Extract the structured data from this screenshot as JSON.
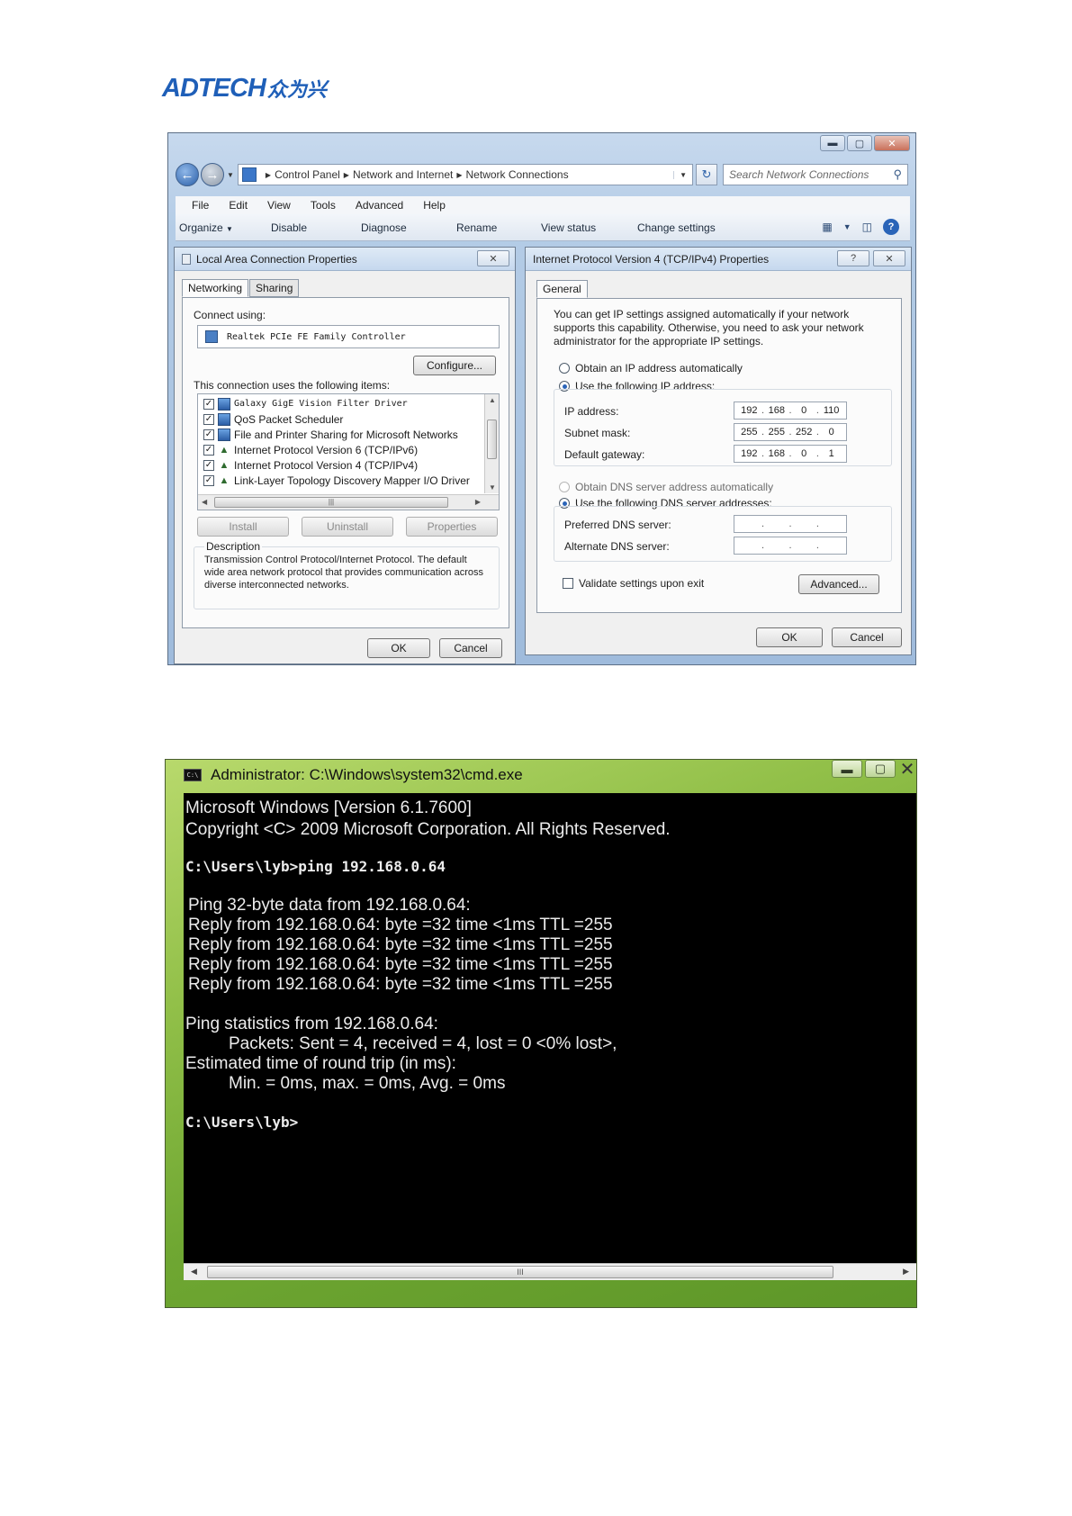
{
  "logo": {
    "latin": "ADTECH",
    "cjk": "众为兴"
  },
  "explorer": {
    "window_controls": {
      "minimize": "▬",
      "maximize": "▢",
      "close": "✕"
    },
    "breadcrumb": [
      "Control Panel",
      "Network and Internet",
      "Network Connections"
    ],
    "search_placeholder": "Search Network Connections",
    "menu": [
      "File",
      "Edit",
      "View",
      "Tools",
      "Advanced",
      "Help"
    ],
    "commands": {
      "organize": "Organize",
      "disable": "Disable",
      "diagnose": "Diagnose",
      "rename": "Rename",
      "view_status": "View status",
      "change_settings": "Change settings"
    }
  },
  "lac_dialog": {
    "title": "Local Area Connection Properties",
    "close": "✕",
    "tabs": [
      "Networking",
      "Sharing"
    ],
    "connect_using_label": "Connect using:",
    "adapter": "Realtek PCIe FE Family Controller",
    "configure": "Configure...",
    "items_label": "This connection uses the following items:",
    "items": [
      {
        "label": "Galaxy GigE Vision Filter Driver",
        "checked": true,
        "icon": "network-component-icon"
      },
      {
        "label": "QoS Packet Scheduler",
        "checked": true,
        "icon": "network-component-icon"
      },
      {
        "label": "File and Printer Sharing for Microsoft Networks",
        "checked": true,
        "icon": "network-component-icon"
      },
      {
        "label": "Internet Protocol Version 6 (TCP/IPv6)",
        "checked": true,
        "icon": "protocol-icon"
      },
      {
        "label": "Internet Protocol Version 4 (TCP/IPv4)",
        "checked": true,
        "icon": "protocol-icon"
      },
      {
        "label": "Link-Layer Topology Discovery Mapper I/O Driver",
        "checked": true,
        "icon": "protocol-icon"
      }
    ],
    "install": "Install",
    "uninstall": "Uninstall",
    "properties": "Properties",
    "description_label": "Description",
    "description": "Transmission Control Protocol/Internet Protocol. The default wide area network protocol that provides communication across diverse interconnected networks.",
    "ok": "OK",
    "cancel": "Cancel"
  },
  "ipv4_dialog": {
    "title": "Internet Protocol Version 4 (TCP/IPv4) Properties",
    "help": "?",
    "close": "✕",
    "tab": "General",
    "intro": "You can get IP settings assigned automatically if your network supports this capability. Otherwise, you need to ask your network administrator for the appropriate IP settings.",
    "obtain_ip": "Obtain an IP address automatically",
    "use_ip": "Use the following IP address:",
    "ip_label": "IP address:",
    "ip": [
      "192",
      "168",
      "0",
      "110"
    ],
    "mask_label": "Subnet mask:",
    "mask": [
      "255",
      "255",
      "252",
      "0"
    ],
    "gateway_label": "Default gateway:",
    "gateway": [
      "192",
      "168",
      "0",
      "1"
    ],
    "obtain_dns": "Obtain DNS server address automatically",
    "use_dns": "Use the following DNS server addresses:",
    "preferred_dns_label": "Preferred DNS server:",
    "alternate_dns_label": "Alternate DNS server:",
    "validate": "Validate settings upon exit",
    "advanced": "Advanced...",
    "ok": "OK",
    "cancel": "Cancel"
  },
  "cmd": {
    "title": "Administrator: C:\\Windows\\system32\\cmd.exe",
    "icon_text": "C:\\",
    "controls": {
      "minimize": "▬",
      "maximize": "▢",
      "close": "✕"
    },
    "lines": {
      "version": "Microsoft Windows [Version 6.1.7600]",
      "copyright": "Copyright <C> 2009 Microsoft Corporation. All Rights Reserved.",
      "prompt_cmd": "C:\\Users\\lyb>ping 192.168.0.64",
      "ping_header": "Ping 32-byte data from 192.168.0.64:",
      "reply1": "Reply from 192.168.0.64: byte =32 time <1ms TTL =255",
      "reply2": "Reply from 192.168.0.64: byte =32 time <1ms TTL =255",
      "reply3": "Reply from 192.168.0.64: byte =32 time <1ms TTL =255",
      "reply4": "Reply from 192.168.0.64: byte =32 time <1ms TTL =255",
      "stats_header": "Ping statistics from 192.168.0.64:",
      "packets": "Packets: Sent = 4, received = 4, lost = 0 <0% lost>,",
      "rtt_header": "Estimated time of round trip (in ms):",
      "rtt": "Min. = 0ms, max. = 0ms, Avg. = 0ms",
      "prompt_end": "C:\\Users\\lyb>"
    },
    "scroll_grip": "III"
  }
}
